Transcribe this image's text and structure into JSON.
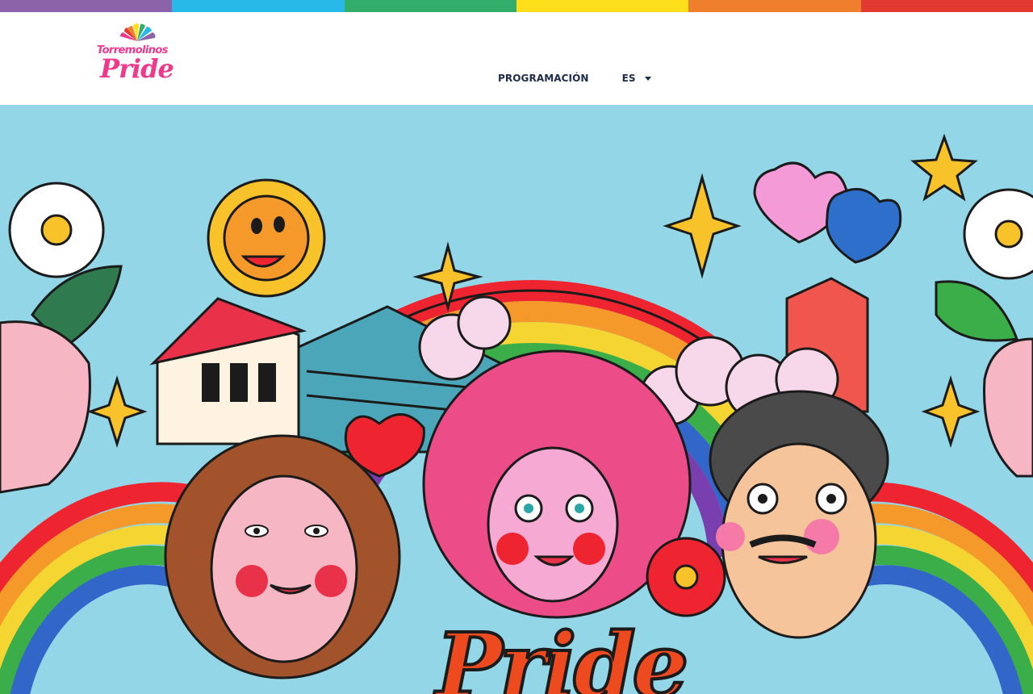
{
  "colors": {
    "stripes": [
      "#8c62a8",
      "#29b9e8",
      "#32ad6a",
      "#ffdf1b",
      "#f07f2d",
      "#e23a31"
    ],
    "brand_pink": "#f0398c",
    "nav_text": "#1d2a4a",
    "hero_sky": "#92d6e7"
  },
  "header": {
    "logo": {
      "line1": "Torremolinos",
      "line2": "Pride"
    },
    "nav": {
      "programacion_label": "PROGRAMACIÓN",
      "language_label": "ES"
    }
  },
  "hero": {
    "banner_text": "Pride"
  }
}
